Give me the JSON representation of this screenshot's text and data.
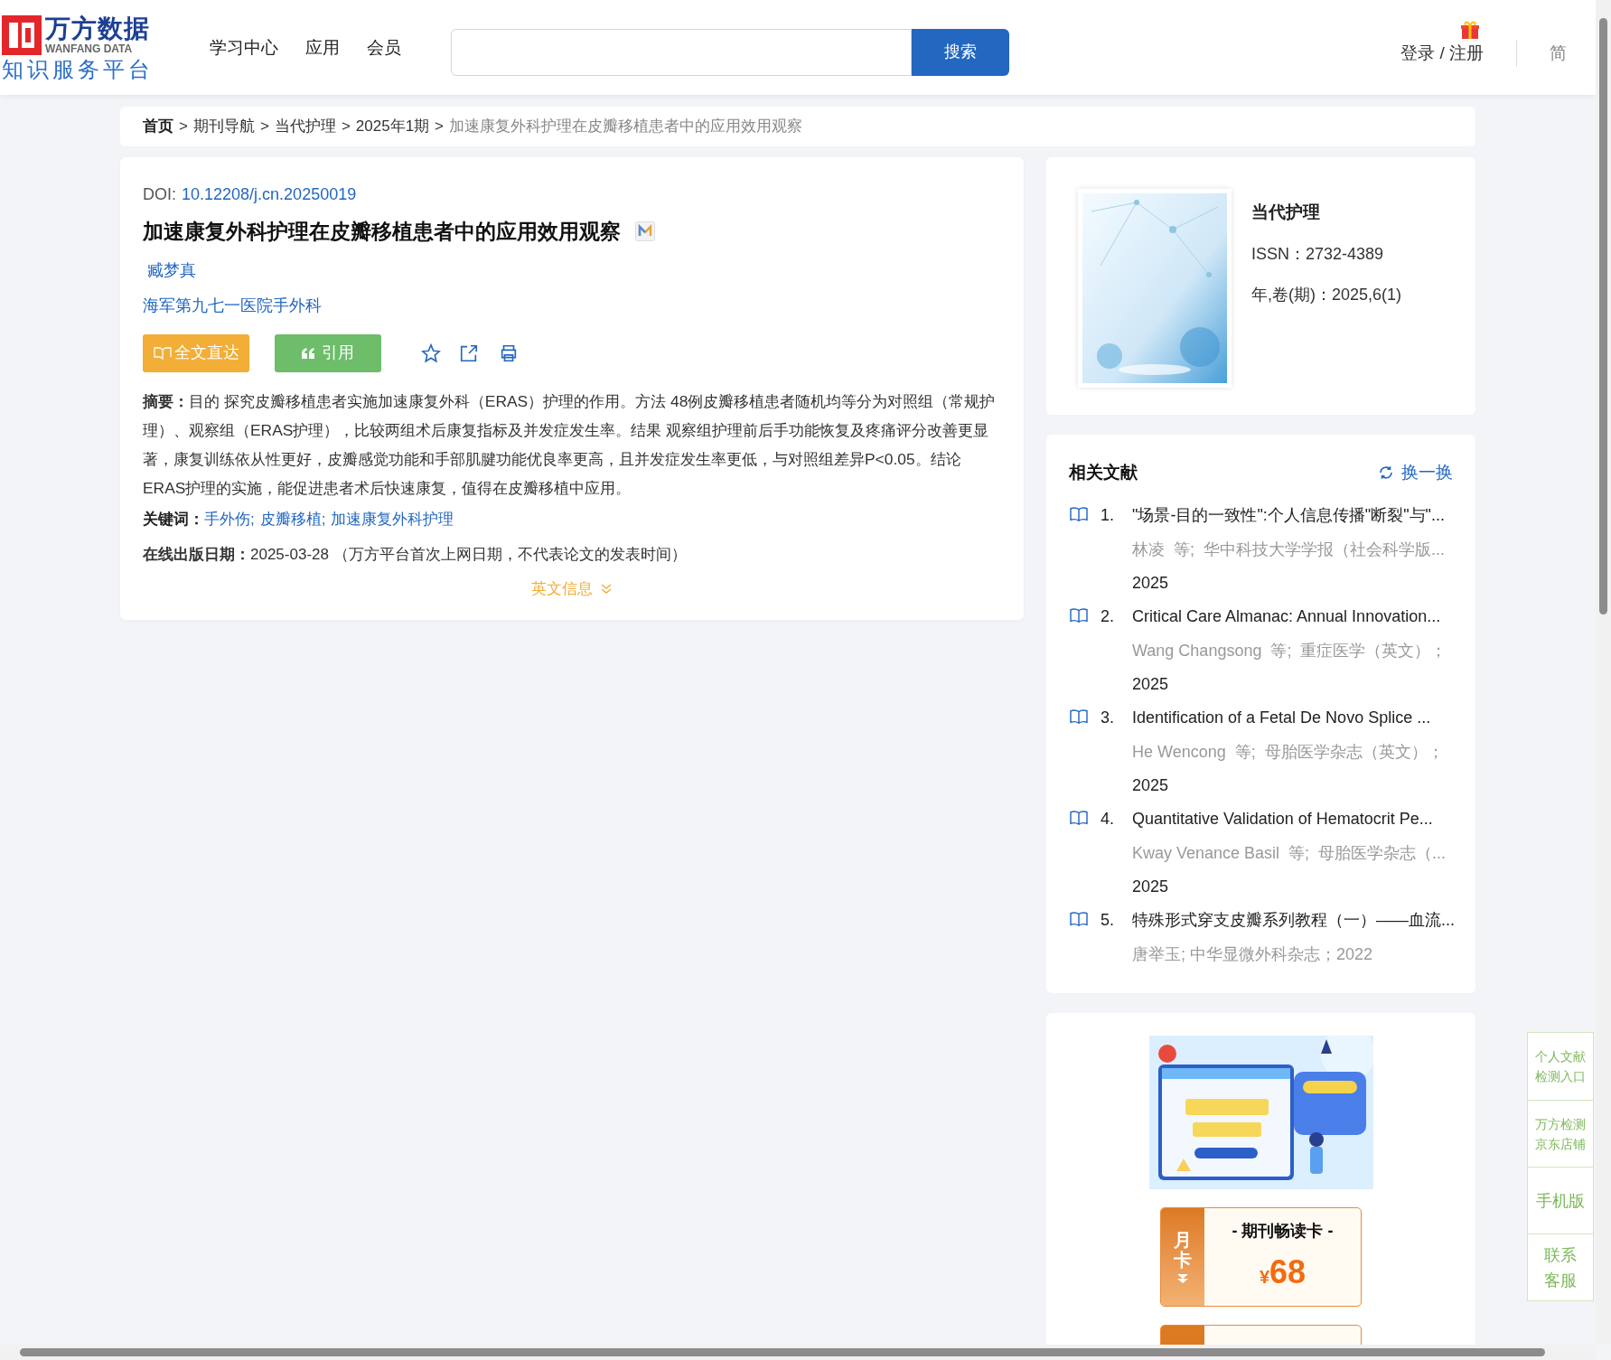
{
  "header": {
    "logo": {
      "name": "万方数据",
      "subtitle": "WANFANG DATA",
      "tagline": "知识服务平台"
    },
    "nav": [
      {
        "label": "学习中心"
      },
      {
        "label": "应用"
      },
      {
        "label": "会员"
      }
    ],
    "search": {
      "button": "搜索"
    },
    "login": "登录 / 注册",
    "language": {
      "label": "简",
      "selected": true
    }
  },
  "breadcrumb_separator": ">",
  "breadcrumb": [
    {
      "label": "首页",
      "kind": "home"
    },
    {
      "label": "期刊导航",
      "kind": "link"
    },
    {
      "label": "当代护理",
      "kind": "link"
    },
    {
      "label": "2025年1期",
      "kind": "link"
    },
    {
      "label": "加速康复外科护理在皮瓣移植患者中的应用效用观察",
      "kind": "current"
    }
  ],
  "article": {
    "doi_label": "DOI:",
    "doi": "10.12208/j.cn.20250019",
    "title": "加速康复外科护理在皮瓣移植患者中的应用效用观察",
    "authors": [
      "臧梦真"
    ],
    "affiliation": "海军第九七一医院手外科",
    "actions": {
      "fulltext": "全文直达",
      "cite": "引用"
    },
    "abstract": "**摘要：**目的 探究皮瓣移植患者实施加速康复外科（ERAS）护理的作用。方法 48例皮瓣移植患者随机均等分为对照组（常规护理）、观察组（ERAS护理），比较两组术后康复指标及并发症发生率。结果 观察组护理前后手功能恢复及疼痛评分改善更显著，康复训练依从性更好，皮瓣感觉功能和手部肌腱功能优良率更高，且并发症发生率更低，与对照组差异P<0.05。结论 ERAS护理的实施，能促进患者术后快速康复，值得在皮瓣移植中应用。",
    "keywords_label": "关键词：",
    "keyword_separator": ";",
    "keywords": [
      "手外伤",
      "皮瓣移植",
      "加速康复外科护理"
    ],
    "date": "**在线出版日期：**2025-03-28 （万方平台首次上网日期，不代表论文的发表时间）",
    "english_toggle": "英文信息"
  },
  "journal": {
    "name": "当代护理",
    "issn": "ISSN：2732-4389",
    "issue": "年,卷(期)：2025,6(1)"
  },
  "related": {
    "title": "相关文献",
    "refresh": "换一换",
    "items": [
      {
        "number": "1.",
        "title": "\"场景-目的一致性\":个人信息传播\"断裂\"与\"...",
        "meta": "林凌  等;  华中科技大学学报（社会科学版...",
        "year": "2025"
      },
      {
        "number": "2.",
        "title": "Critical Care Almanac: Annual Innovation...",
        "meta": "Wang Changsong  等;  重症医学（英文）；",
        "year": "2025"
      },
      {
        "number": "3.",
        "title": "Identification of a Fetal De Novo Splice ...",
        "meta": "He Wencong  等;  母胎医学杂志（英文）；",
        "year": "2025"
      },
      {
        "number": "4.",
        "title": "Quantitative Validation of Hematocrit Pe...",
        "meta": "Kway Venance Basil  等;  母胎医学杂志（...",
        "year": "2025"
      },
      {
        "number": "5.",
        "title": "特殊形式穿支皮瓣系列教程（一）——血流...",
        "meta": "唐举玉; 中华显微外科杂志；2022"
      }
    ]
  },
  "promo": {
    "card": {
      "badge": "月卡",
      "title": "- 期刊畅读卡 -",
      "currency": "¥",
      "price": "68"
    }
  },
  "float_menu": [
    {
      "label": "个人文献检测入口",
      "kind": "small"
    },
    {
      "label": "万方检测京东店铺",
      "kind": "small"
    },
    {
      "label": "手机版",
      "kind": "large"
    },
    {
      "label": "联系客服",
      "kind": "stacked"
    }
  ]
}
